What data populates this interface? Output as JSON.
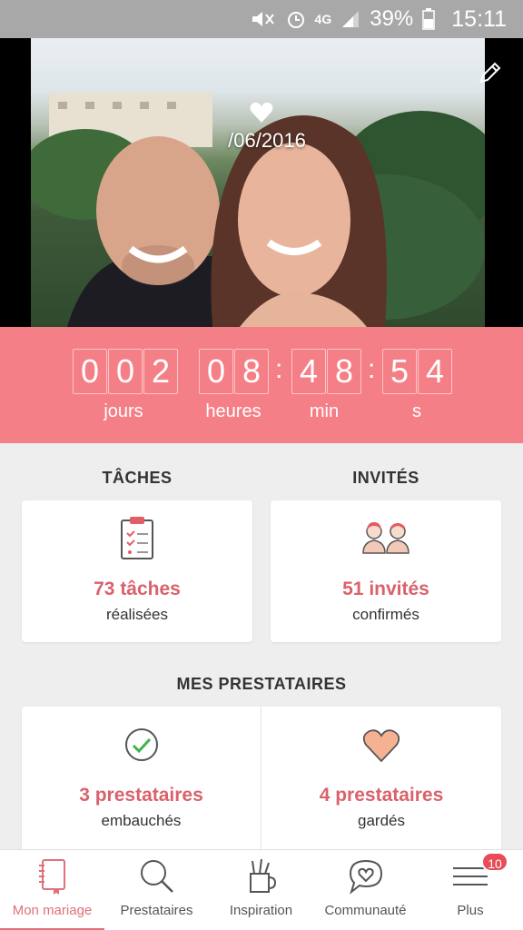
{
  "status_bar": {
    "network": "4G",
    "battery": "39%",
    "time": "15:11"
  },
  "hero": {
    "date": "/06/2016"
  },
  "countdown": {
    "days_digits": [
      "0",
      "0",
      "2"
    ],
    "hours_digits": [
      "0",
      "8"
    ],
    "min_digits": [
      "4",
      "8"
    ],
    "sec_digits": [
      "5",
      "4"
    ],
    "labels": {
      "days": "jours",
      "hours": "heures",
      "min": "min",
      "sec": "s"
    }
  },
  "tasks": {
    "title": "TÂCHES",
    "count": "73 tâches",
    "status": "réalisées"
  },
  "guests": {
    "title": "INVITÉS",
    "count": "51 invités",
    "status": "confirmés"
  },
  "vendors": {
    "title": "MES PRESTATAIRES",
    "hired": {
      "count": "3 prestataires",
      "status": "embauchés"
    },
    "saved": {
      "count": "4 prestataires",
      "status": "gardés"
    }
  },
  "nav": {
    "items": [
      {
        "label": "Mon mariage",
        "icon": "notebook-icon"
      },
      {
        "label": "Prestataires",
        "icon": "search-icon"
      },
      {
        "label": "Inspiration",
        "icon": "pen-cup-icon"
      },
      {
        "label": "Communauté",
        "icon": "chat-heart-icon"
      },
      {
        "label": "Plus",
        "icon": "menu-icon"
      }
    ],
    "badge": "10"
  },
  "colors": {
    "accent": "#f57f87",
    "accent_text": "#d9626b",
    "active_nav": "#e0707a"
  }
}
